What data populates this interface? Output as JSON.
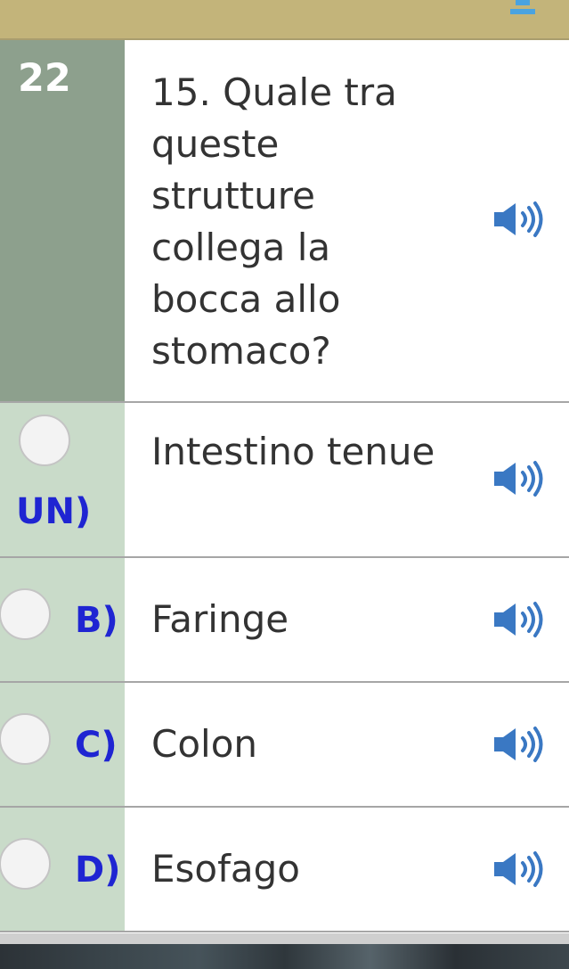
{
  "question": {
    "number": "22",
    "text": "15. Quale tra queste strutture collega la bocca allo stomaco?",
    "audio_icon": "speaker-icon"
  },
  "answers": [
    {
      "letter": "UN)",
      "text": "Intestino tenue",
      "audio_icon": "speaker-icon",
      "selected": false
    },
    {
      "letter": "B)",
      "text": "Faringe",
      "audio_icon": "speaker-icon",
      "selected": false
    },
    {
      "letter": "C)",
      "text": "Colon",
      "audio_icon": "speaker-icon",
      "selected": false
    },
    {
      "letter": "D)",
      "text": "Esofago",
      "audio_icon": "speaker-icon",
      "selected": false
    }
  ],
  "colors": {
    "topbar": "#c3b47a",
    "question_panel": "#8da08d",
    "answer_panel": "#c9dbc9",
    "letter": "#1f25d2",
    "speaker": "#3a78c3"
  }
}
